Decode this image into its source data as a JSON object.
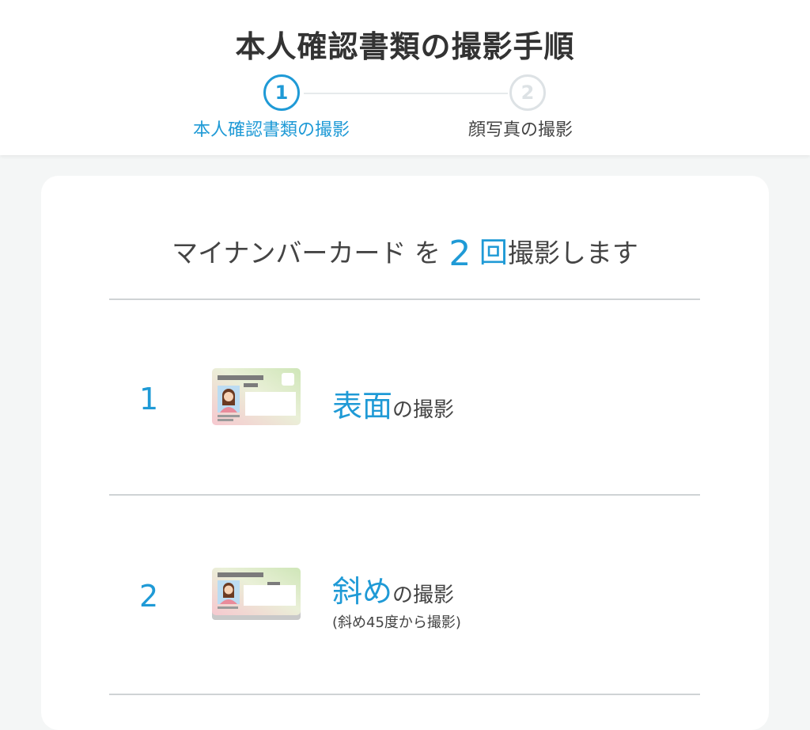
{
  "header": {
    "title": "本人確認書類の撮影手順",
    "steps": [
      {
        "number": "1",
        "label": "本人確認書類の撮影",
        "state": "active"
      },
      {
        "number": "2",
        "label": "顔写真の撮影",
        "state": "inactive"
      }
    ]
  },
  "main": {
    "headline": {
      "doc": "マイナンバーカード",
      "particle": " を ",
      "count": "2",
      "unit": "回",
      "suffix": "撮影します"
    },
    "items": [
      {
        "number": "1",
        "highlight": "表面",
        "suffix": "の撮影",
        "icon": "id-card-front-icon"
      },
      {
        "number": "2",
        "highlight": "斜め",
        "suffix": "の撮影",
        "note": "(斜め45度から撮影)",
        "icon": "id-card-angled-icon"
      }
    ]
  },
  "colors": {
    "accent": "#1f9ad6",
    "inactive": "#dde2e5",
    "background": "#f4f6f6"
  }
}
